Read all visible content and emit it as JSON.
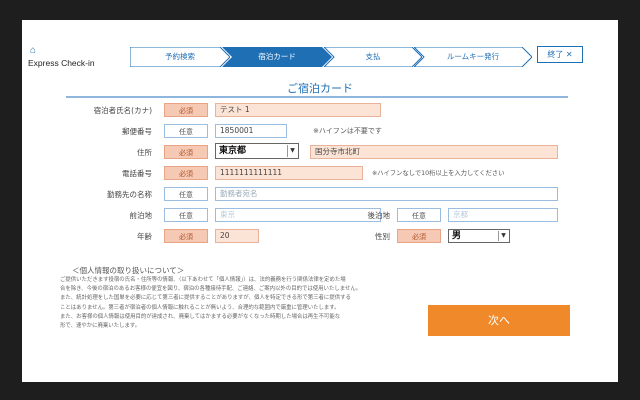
{
  "header": {
    "brand": "Express Check-in",
    "steps": [
      "予約検索",
      "宿泊カード",
      "支払",
      "ルームキー発行"
    ],
    "exit_label": "終了 ✕"
  },
  "title": "ご宿泊カード",
  "tags": {
    "required": "必須",
    "optional": "任意"
  },
  "form": {
    "name_kana": {
      "label": "宿泊者氏名(カナ)",
      "value": "テスト 1"
    },
    "postal": {
      "label": "郵便番号",
      "value": "1850001",
      "hint": "※ハイフンは不要です"
    },
    "address": {
      "label": "住所",
      "prefecture": "東京都",
      "city": "国分寺市北町"
    },
    "phone": {
      "label": "電話番号",
      "value": "1111111111111",
      "hint": "※ハイフンなしで10桁以上を入力してください"
    },
    "company": {
      "label": "勤務先の名称",
      "placeholder": "勤務者宛名"
    },
    "prev_stay": {
      "label": "前泊地",
      "placeholder": "東京"
    },
    "next_stay": {
      "label": "後泊地",
      "placeholder": "京都"
    },
    "age": {
      "label": "年齢",
      "value": "20"
    },
    "gender": {
      "label": "性別",
      "value": "男"
    }
  },
  "privacy": {
    "heading": "＜個人情報の取り扱いについて＞",
    "lines": [
      "ご提供いただきます投宿の氏名・住所等の情報、（以下あわせて「個人情報」）は、法的義務を行う関係法律を定めた場",
      "合を除き、今後の宿泊のあるお客様の便宜を図り、宿泊の各種接待手配、ご連絡、ご案内以外の目的では使用いたしません。",
      "また、統計処理をした国単を必要に応じて第三者に提供することがありますが、個人を特定できる形で第三者に提供する",
      "ことはありません。第三者が宿泊者の個人情報に触れることが無いよう、合理的な範囲内で厳重に管理いたします。",
      "また、お客様の個人情報は使用目的が達成され、廃棄してはかまする必要がなくなった時期した場合は再生不可能な",
      "形で、速やかに廃棄いたします。"
    ]
  },
  "next_label": "次へ",
  "colors": {
    "accent": "#1f6fb5",
    "required_bg": "#fbe3d5",
    "button": "#f0892a"
  }
}
